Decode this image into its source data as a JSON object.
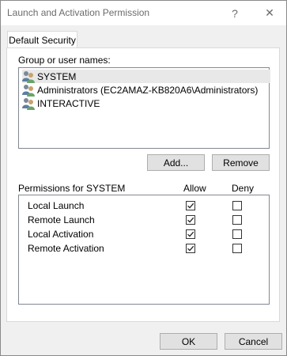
{
  "window": {
    "title": "Launch and Activation Permission",
    "help_glyph": "?",
    "close_glyph": "✕"
  },
  "tab": {
    "label": "Default Security"
  },
  "group_section": {
    "label": "Group or user names:",
    "items": [
      {
        "name": "SYSTEM",
        "icon": "group-users-icon",
        "selected": true
      },
      {
        "name": "Administrators (EC2AMAZ-KB820A6\\Administrators)",
        "icon": "group-users-icon",
        "selected": false
      },
      {
        "name": "INTERACTIVE",
        "icon": "group-users-icon",
        "selected": false
      }
    ]
  },
  "buttons": {
    "add": "Add...",
    "remove": "Remove",
    "ok": "OK",
    "cancel": "Cancel"
  },
  "permissions": {
    "header": "Permissions for SYSTEM",
    "allow_header": "Allow",
    "deny_header": "Deny",
    "rows": [
      {
        "name": "Local Launch",
        "allow": true,
        "deny": false
      },
      {
        "name": "Remote Launch",
        "allow": true,
        "deny": false
      },
      {
        "name": "Local Activation",
        "allow": true,
        "deny": false
      },
      {
        "name": "Remote Activation",
        "allow": true,
        "deny": false
      }
    ]
  }
}
